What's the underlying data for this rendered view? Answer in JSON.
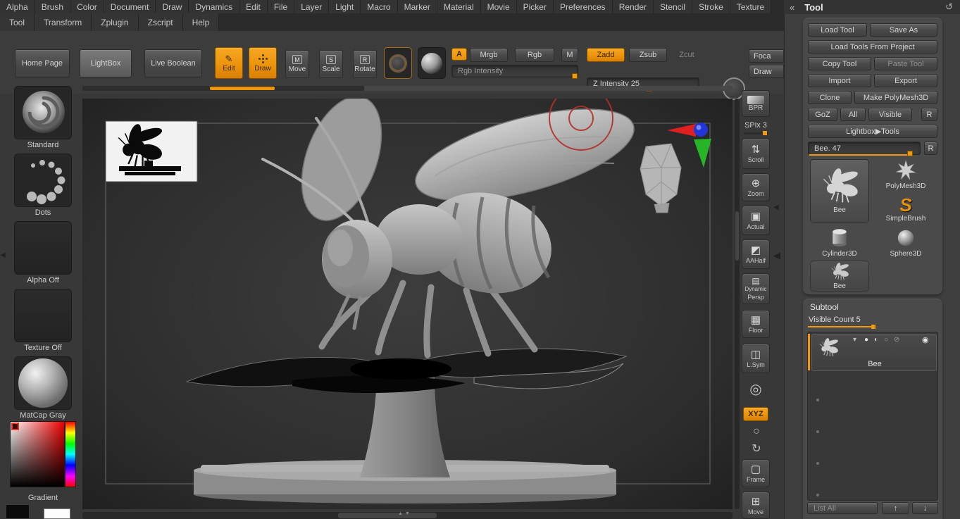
{
  "icons": {
    "collapse_left": "◀",
    "panel_collapse": "«",
    "refresh": "↺",
    "edit": "✎",
    "scroll": "⇅",
    "zoom": "⊕",
    "actual": "▣",
    "aahalf": "◩",
    "persp": "▤",
    "floor": "▦",
    "lsym": "◫",
    "localsym": "◎",
    "orbit": "○",
    "spin": "↻",
    "frame": "▢",
    "move": "⊞",
    "chevron_down": "▾",
    "dot_full": "●",
    "dot_half": "◐",
    "dot_empty": "○",
    "slash": "⊘",
    "eye": "◉",
    "up": "↑",
    "down": "↓",
    "tri_up": "▲",
    "tri_down": "▼"
  },
  "menubar": {
    "row1": [
      "Alpha",
      "Brush",
      "Color",
      "Document",
      "Draw",
      "Dynamics",
      "Edit",
      "File",
      "Layer",
      "Light",
      "Macro",
      "Marker",
      "Material",
      "Movie",
      "Picker",
      "Preferences",
      "Render",
      "Stencil",
      "Stroke",
      "Texture"
    ],
    "row2": [
      "Tool",
      "Transform",
      "Zplugin",
      "Zscript",
      "Help"
    ]
  },
  "toolbar": {
    "home_page": "Home Page",
    "lightbox": "LightBox",
    "live_boolean": "Live Boolean",
    "edit": "Edit",
    "draw": "Draw",
    "move": "Move",
    "move_badge": "M",
    "scale": "Scale",
    "scale_badge": "S",
    "rotate": "Rotate",
    "rotate_badge": "R",
    "a_badge": "A",
    "mrgb": "Mrgb",
    "rgb": "Rgb",
    "m": "M",
    "rgb_intensity": "Rgb Intensity",
    "zadd": "Zadd",
    "zsub": "Zsub",
    "zcut": "Zcut",
    "z_intensity": "Z Intensity 25",
    "foca": "Foca",
    "draw_right": "Draw"
  },
  "left_palette": {
    "standard": "Standard",
    "dots": "Dots",
    "alpha_off": "Alpha Off",
    "texture_off": "Texture Off",
    "matcap_gray": "MatCap Gray",
    "gradient": "Gradient"
  },
  "right_rail": {
    "bpr": "BPR",
    "spix": "SPix 3",
    "scroll": "Scroll",
    "zoom": "Zoom",
    "actual": "Actual",
    "aahalf": "AAHalf",
    "dynamic": "Dynamic",
    "persp": "Persp",
    "floor": "Floor",
    "lsym": "L.Sym",
    "xyz": "XYZ",
    "frame": "Frame",
    "move": "Move"
  },
  "tool_panel": {
    "title": "Tool",
    "load_tool": "Load Tool",
    "save_as": "Save As",
    "load_tools_from_project": "Load Tools From Project",
    "copy_tool": "Copy Tool",
    "paste_tool": "Paste Tool",
    "import": "Import",
    "export": "Export",
    "clone": "Clone",
    "make_polymesh3d": "Make PolyMesh3D",
    "goz": "GoZ",
    "all": "All",
    "visible": "Visible",
    "r": "R",
    "lightbox_tools": "Lightbox▶Tools",
    "active_slider": "Bee. 47",
    "r2": "R",
    "items": [
      {
        "label": "Bee"
      },
      {
        "label": "PolyMesh3D"
      },
      {
        "label": "SimpleBrush"
      },
      {
        "label": "Cylinder3D"
      },
      {
        "label": "Sphere3D"
      },
      {
        "label": "Bee"
      }
    ]
  },
  "subtool_panel": {
    "title": "Subtool",
    "visible_count": "Visible Count 5",
    "item_label": "Bee",
    "list_all": "List All"
  }
}
